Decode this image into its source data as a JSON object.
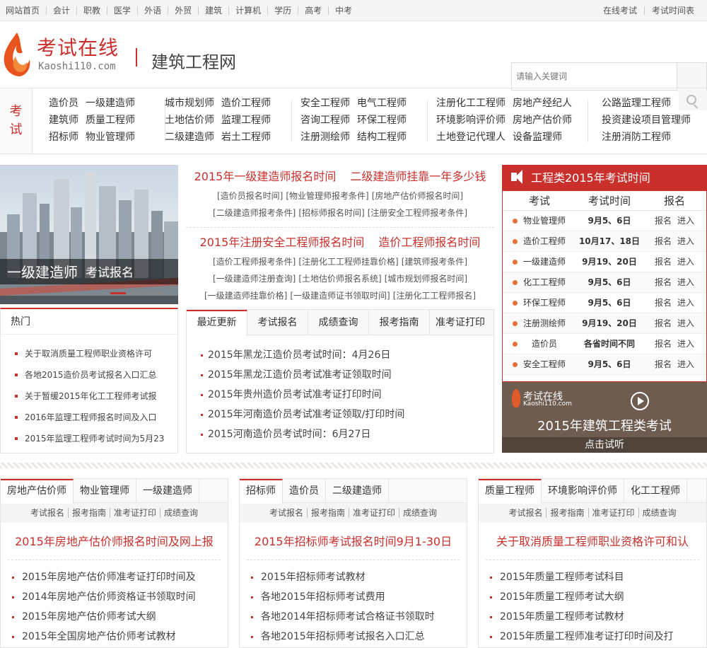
{
  "topbar": {
    "nav": [
      "网站首页",
      "会计",
      "职教",
      "医学",
      "外语",
      "外贸",
      "建筑",
      "计算机",
      "学历",
      "高考",
      "中考"
    ],
    "right": [
      "在线考试",
      "考试时间表"
    ]
  },
  "header": {
    "logo_cn": "考试在线",
    "logo_en": "Kaoshi110.com",
    "site_title": "建筑工程网",
    "search_placeholder": "请输入关键词"
  },
  "categories": {
    "tag": [
      "考",
      "试"
    ],
    "groups": [
      [
        [
          "造价员",
          "一级建造师"
        ],
        [
          "建筑师",
          "质量工程师"
        ],
        [
          "招标师",
          "物业管理师"
        ]
      ],
      [
        [
          "城市规划师",
          "造价工程师"
        ],
        [
          "土地估价师",
          "监理工程师"
        ],
        [
          "二级建造师",
          "岩土工程师"
        ]
      ],
      [
        [
          "安全工程师",
          "电气工程师"
        ],
        [
          "咨询工程师",
          "环保工程师"
        ],
        [
          "注册测绘师",
          "结构工程师"
        ]
      ],
      [
        [
          "注册化工工程师",
          "房地产经纪人"
        ],
        [
          "环境影响评价师",
          "房地产估价师"
        ],
        [
          "土地登记代理人",
          "设备监理师"
        ]
      ],
      [
        [
          "公路监理工程师"
        ],
        [
          "投资建设项目管理师"
        ],
        [
          "注册消防工程师"
        ]
      ]
    ]
  },
  "slider": {
    "caption_main": "一级建造师",
    "caption_sub": "考试报名"
  },
  "hot": {
    "title": "热门",
    "items": [
      "关于取消质量工程师职业资格许可",
      "各地2015造价员考试报名入口汇总",
      "关于暂缓2015年化工工程师考试报",
      "2016年监理工程师报名时间及入口",
      "2015年监理工程师考试时间为5月23"
    ]
  },
  "headlines": {
    "block1": {
      "big": [
        "2015年一级建造师报名时间",
        "二级建造师挂靠一年多少钱"
      ],
      "subs": [
        [
          "[造价员报名时间]",
          "[物业管理师报考条件]",
          "[房地产估价师报名时间]"
        ],
        [
          "[二级建造师报考条件]",
          "[招标师报名时间]",
          "[注册安全工程师报考条件]"
        ]
      ]
    },
    "block2": {
      "big": [
        "2015年注册安全工程师报名时间",
        "造价工程师报名时间"
      ],
      "subs": [
        [
          "[造价工程师报考条件]",
          "[注册化工工程师挂靠价格]",
          "[建筑师报考条件]"
        ],
        [
          "[一级建造师注册查询]",
          "[土地估价师报名系统]",
          "[城市规划师报名时间]"
        ],
        [
          "[一级建造师挂靠价格]",
          "[一级建造师证书领取时间]",
          "[注册化工工程师报名]"
        ]
      ]
    }
  },
  "news_tabs": {
    "tabs": [
      "最近更新",
      "考试报名",
      "成绩查询",
      "报考指南",
      "准考证打印"
    ],
    "items": [
      "2015年黑龙江造价员考试时间：4月26日",
      "2015年黑龙江造价员考试准考证领取时间",
      "2015年贵州造价员考试准考证打印时间",
      "2015年河南造价员考试准考证领取/打印时间",
      "2015河南造价员考试时间：6月27日"
    ]
  },
  "exam_schedule": {
    "title": "工程类2015年考试时间",
    "columns": [
      "考试",
      "考试时间",
      "报名"
    ],
    "enroll": "报名",
    "enter": "进入",
    "rows": [
      {
        "name": "物业管理师",
        "time": "9月5、6日"
      },
      {
        "name": "造价工程师",
        "time": "10月17、18日"
      },
      {
        "name": "一级建造师",
        "time": "9月19、20日"
      },
      {
        "name": "化工工程师",
        "time": "9月5、6日"
      },
      {
        "name": "环保工程师",
        "time": "9月5、6日"
      },
      {
        "name": "注册测绘师",
        "time": "9月19、20日"
      },
      {
        "name": "造价员",
        "time": "各省时间不同"
      },
      {
        "name": "安全工程师",
        "time": "9月5、6日"
      }
    ]
  },
  "video": {
    "logo_cn": "考试在线",
    "logo_en": "Kaoshi110.com",
    "title": "2015年建筑工程类考试",
    "action": "点击试听"
  },
  "panels": [
    {
      "tabs": [
        "房地产估价师",
        "物业管理师",
        "一级建造师"
      ],
      "links": [
        "考试报名",
        "报考指南",
        "准考证打印",
        "成绩查询"
      ],
      "headline": "2015年房地产估价师报名时间及网上报",
      "items": [
        "2015年房地产估价师准考证打印时间及",
        "2014年房地产估价师资格证书领取时间",
        "2015年房地产估价师考试大纲",
        "2015年全国房地产估价师考试教材"
      ]
    },
    {
      "tabs": [
        "招标师",
        "造价员",
        "二级建造师"
      ],
      "links": [
        "考试报名",
        "报考指南",
        "准考证打印",
        "成绩查询"
      ],
      "headline": "2015年招标师考试报名时间9月1-30日",
      "items": [
        "2015年招标师考试教材",
        "各地2015年招标师考试费用",
        "各地2014年招标师考试合格证书领取时",
        "各地2015年招标师考试报名入口汇总"
      ]
    },
    {
      "tabs": [
        "质量工程师",
        "环境影响评价师",
        "化工工程师"
      ],
      "links": [
        "考试报名",
        "报考指南",
        "准考证打印",
        "成绩查询"
      ],
      "headline": "关于取消质量工程师职业资格许可和认",
      "items": [
        "2015年质量工程师考试科目",
        "2015年质量工程师考试大纲",
        "2015年质量工程师考试教材",
        "2015年质量工程师准考证打印时间及打"
      ]
    }
  ],
  "colors": {
    "accent": "#c9302c",
    "dot": "#e8713a",
    "video_bg": "#6d5c4f"
  }
}
